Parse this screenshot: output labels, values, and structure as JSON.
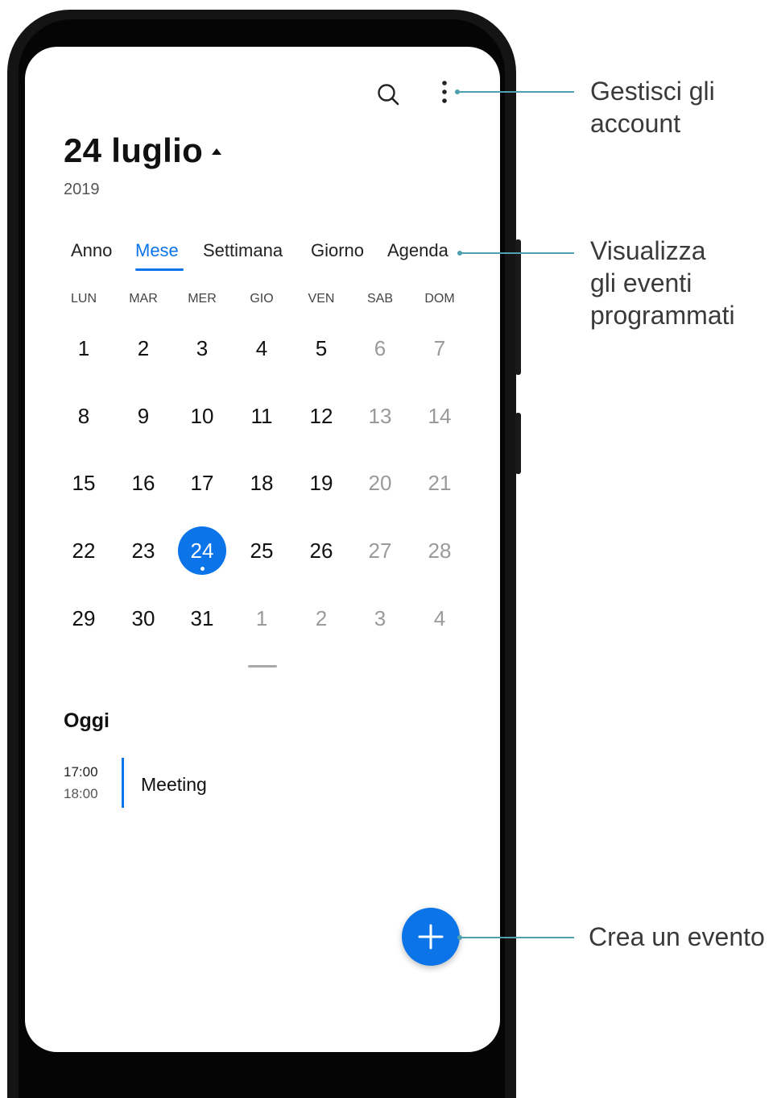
{
  "header": {
    "date_title": "24 luglio",
    "year": "2019"
  },
  "tabs": [
    {
      "label": "Anno",
      "active": false
    },
    {
      "label": "Mese",
      "active": true
    },
    {
      "label": "Settimana",
      "active": false
    },
    {
      "label": "Giorno",
      "active": false
    },
    {
      "label": "Agenda",
      "active": false
    }
  ],
  "weekdays": [
    "LUN",
    "MAR",
    "MER",
    "GIO",
    "VEN",
    "SAB",
    "DOM"
  ],
  "month_grid": [
    [
      {
        "d": "1"
      },
      {
        "d": "2"
      },
      {
        "d": "3"
      },
      {
        "d": "4"
      },
      {
        "d": "5"
      },
      {
        "d": "6",
        "muted": true
      },
      {
        "d": "7",
        "muted": true
      }
    ],
    [
      {
        "d": "8"
      },
      {
        "d": "9"
      },
      {
        "d": "10"
      },
      {
        "d": "11"
      },
      {
        "d": "12"
      },
      {
        "d": "13",
        "muted": true
      },
      {
        "d": "14",
        "muted": true
      }
    ],
    [
      {
        "d": "15"
      },
      {
        "d": "16"
      },
      {
        "d": "17"
      },
      {
        "d": "18"
      },
      {
        "d": "19"
      },
      {
        "d": "20",
        "muted": true
      },
      {
        "d": "21",
        "muted": true
      }
    ],
    [
      {
        "d": "22"
      },
      {
        "d": "23"
      },
      {
        "d": "24",
        "today": true
      },
      {
        "d": "25"
      },
      {
        "d": "26"
      },
      {
        "d": "27",
        "muted": true
      },
      {
        "d": "28",
        "muted": true
      }
    ],
    [
      {
        "d": "29"
      },
      {
        "d": "30"
      },
      {
        "d": "31"
      },
      {
        "d": "1",
        "muted": true
      },
      {
        "d": "2",
        "muted": true
      },
      {
        "d": "3",
        "muted": true
      },
      {
        "d": "4",
        "muted": true
      }
    ]
  ],
  "today_section": {
    "heading": "Oggi",
    "event": {
      "start": "17:00",
      "end": "18:00",
      "title": "Meeting"
    }
  },
  "icons": {
    "search": "search-icon",
    "more": "more-vertical-icon",
    "add": "plus-icon",
    "sort": "caret-up-icon"
  },
  "callouts": {
    "accounts": [
      "Gestisci gli",
      "account"
    ],
    "events": [
      "Visualizza",
      "gli eventi",
      "programmati"
    ],
    "create": [
      "Crea un evento"
    ]
  },
  "colors": {
    "accent": "#0a74e8",
    "callout_line": "#4fa0ae"
  }
}
